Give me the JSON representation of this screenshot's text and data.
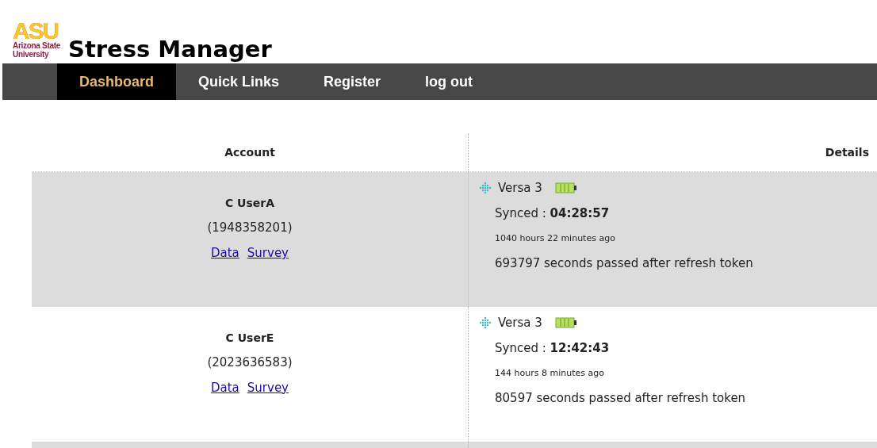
{
  "logo": {
    "letters": "ASU",
    "name_lines": [
      "Arizona State",
      "University"
    ]
  },
  "title": "Stress Manager",
  "nav": [
    {
      "label": "Dashboard",
      "selected": true
    },
    {
      "label": "Quick Links",
      "selected": false
    },
    {
      "label": "Register",
      "selected": false
    },
    {
      "label": "log out",
      "selected": false
    }
  ],
  "table": {
    "columns": [
      "Account",
      "Details"
    ],
    "rows": [
      {
        "name": "C UserA",
        "id": "(1948358201)",
        "links": [
          "Data",
          "Survey"
        ],
        "device": "Versa 3",
        "synced_label": "Synced :",
        "synced_time": "04:28:57",
        "ago": "1040 hours 22 minutes ago",
        "token": "693797 seconds passed after refresh token"
      },
      {
        "name": "C UserE",
        "id": "(2023636583)",
        "links": [
          "Data",
          "Survey"
        ],
        "device": "Versa 3",
        "synced_label": "Synced :",
        "synced_time": "12:42:43",
        "ago": "144 hours 8 minutes ago",
        "token": "80597 seconds passed after refresh token"
      }
    ]
  }
}
